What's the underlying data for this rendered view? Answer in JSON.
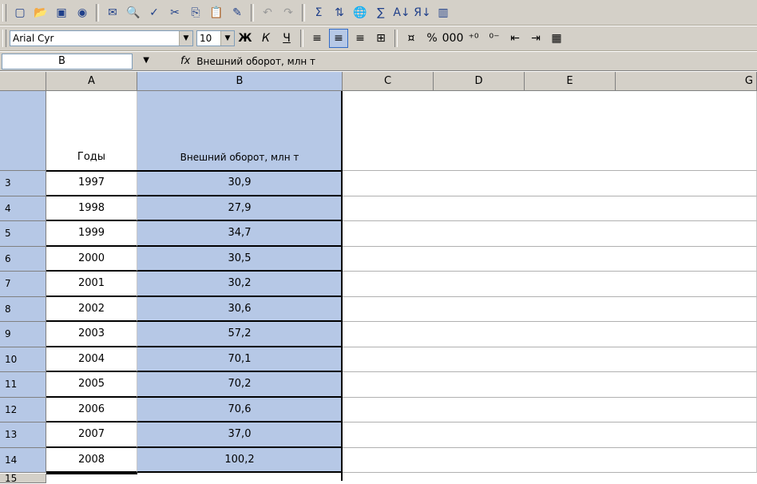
{
  "toolbar_standard": {
    "icons": [
      "new-icon",
      "open-icon",
      "save-icon",
      "permission-icon",
      "mail-icon",
      "print-preview-icon",
      "spelling-icon",
      "cut-icon",
      "copy-icon",
      "paste-icon",
      "format-painter-icon",
      "undo-icon",
      "redo-icon",
      "insert-function-icon",
      "sort-icon",
      "hyperlink-icon",
      "autosum-icon",
      "sort-asc-icon",
      "sort-desc-icon",
      "chart-icon"
    ]
  },
  "toolbar_format": {
    "font_name": "Arial Cyr",
    "font_size": "10"
  },
  "formula_bar": {
    "name_box": "B",
    "fx_label": "fx",
    "content": "Внешний оборот, млн т"
  },
  "columns": [
    "A",
    "B",
    "C",
    "D",
    "E",
    "G"
  ],
  "header_row": {
    "year": "Годы",
    "value": "Внешний оборот, млн т"
  },
  "rows": [
    {
      "num": "3",
      "year": "1997",
      "value": "30,9"
    },
    {
      "num": "4",
      "year": "1998",
      "value": "27,9"
    },
    {
      "num": "5",
      "year": "1999",
      "value": "34,7"
    },
    {
      "num": "6",
      "year": "2000",
      "value": "30,5"
    },
    {
      "num": "7",
      "year": "2001",
      "value": "30,2"
    },
    {
      "num": "8",
      "year": "2002",
      "value": "30,6"
    },
    {
      "num": "9",
      "year": "2003",
      "value": "57,2"
    },
    {
      "num": "10",
      "year": "2004",
      "value": "70,1"
    },
    {
      "num": "11",
      "year": "2005",
      "value": "70,2"
    },
    {
      "num": "12",
      "year": "2006",
      "value": "70,6"
    },
    {
      "num": "13",
      "year": "2007",
      "value": "37,0"
    },
    {
      "num": "14",
      "year": "2008",
      "value": "100,2"
    }
  ],
  "last_row_num": "15",
  "colors": {
    "selection": "#b6c8e6",
    "chrome": "#d4d0c8"
  }
}
